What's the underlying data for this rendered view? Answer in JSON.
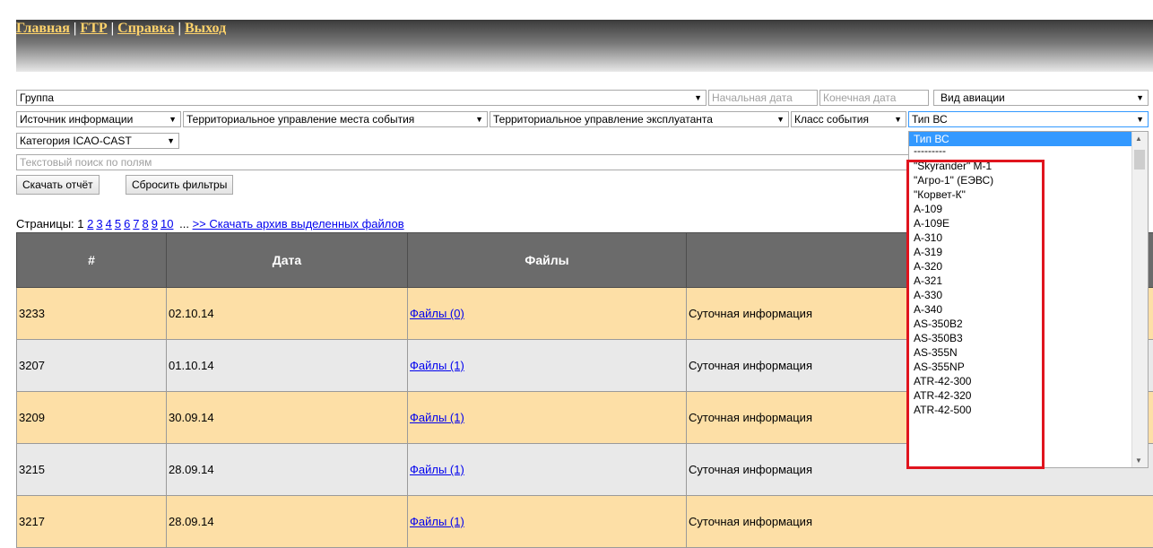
{
  "nav": [
    "Главная",
    "FTP",
    "Справка",
    "Выход"
  ],
  "filters": {
    "group": "Группа",
    "date_start_placeholder": "Начальная дата",
    "date_end_placeholder": "Конечная дата",
    "aviation_type": "Вид авиации",
    "source": "Источник информации",
    "territory_event": "Территориальное управление места события",
    "territory_operator": "Территориальное управление эксплуатанта",
    "event_class": "Класс события",
    "aircraft_type": "Тип ВС",
    "icao_category": "Категория ICAO-CAST",
    "search_placeholder": "Текстовый поиск по полям",
    "arrow": "▼"
  },
  "buttons": {
    "download_report": "Скачать отчёт",
    "reset_filters": "Сбросить фильтры"
  },
  "pagination": {
    "label": "Страницы: 1",
    "pages": [
      "2",
      "3",
      "4",
      "5",
      "6",
      "7",
      "8",
      "9",
      "10"
    ],
    "ellipsis": "...",
    "download_archive": ">> Скачать архив выделенных файлов"
  },
  "table": {
    "columns": [
      "#",
      "Дата",
      "Файлы",
      ""
    ],
    "rows": [
      {
        "num": "3233",
        "date": "02.10.14",
        "files": "Файлы (0)",
        "desc": "Суточная информация"
      },
      {
        "num": "3207",
        "date": "01.10.14",
        "files": "Файлы (1)",
        "desc": "Суточная информация"
      },
      {
        "num": "3209",
        "date": "30.09.14",
        "files": "Файлы (1)",
        "desc": "Суточная информация"
      },
      {
        "num": "3215",
        "date": "28.09.14",
        "files": "Файлы (1)",
        "desc": "Суточная информация"
      },
      {
        "num": "3217",
        "date": "28.09.14",
        "files": "Файлы (1)",
        "desc": "Суточная информация"
      }
    ]
  },
  "dropdown": {
    "items": [
      "Тип ВС",
      "---------",
      "\"Skyrander\" M-1",
      "\"Агро-1\" (ЕЭВС)",
      "\"Корвет-К\"",
      "A-109",
      "A-109E",
      "A-310",
      "A-319",
      "A-320",
      "A-321",
      "A-330",
      "A-340",
      "AS-350B2",
      "AS-350B3",
      "AS-355N",
      "AS-355NP",
      "ATR-42-300",
      "ATR-42-320",
      "ATR-42-500"
    ],
    "selected_index": 0,
    "highlight_color": "#e0141e"
  }
}
